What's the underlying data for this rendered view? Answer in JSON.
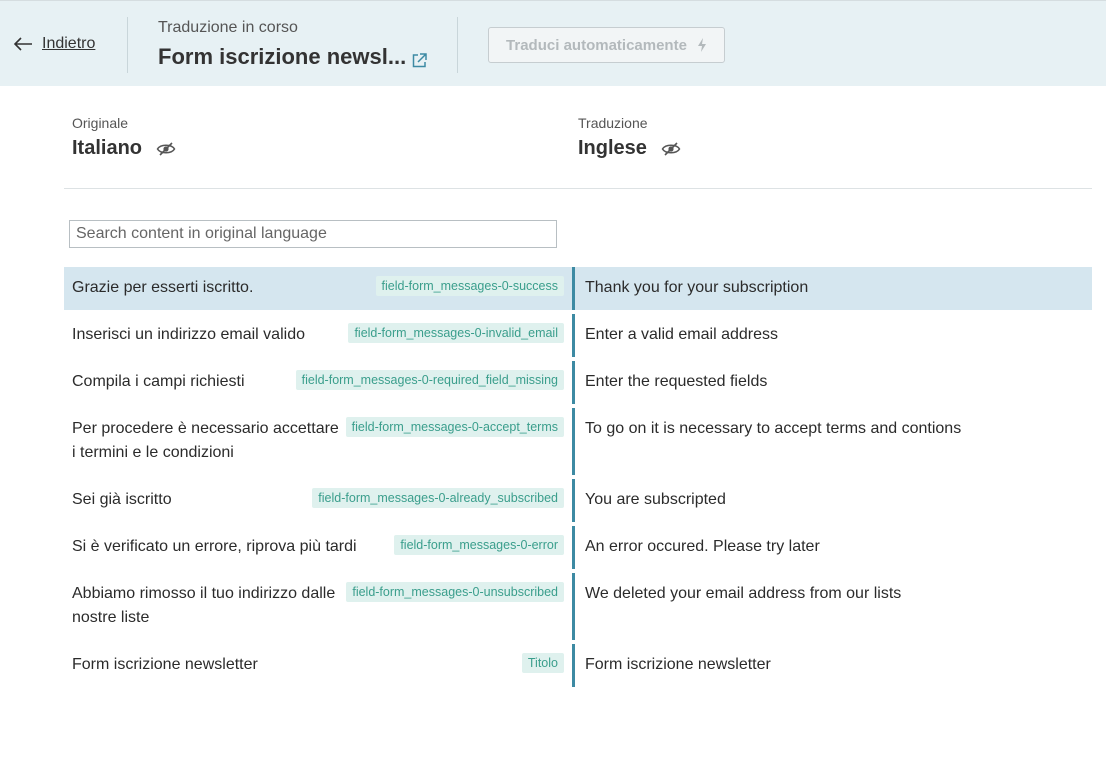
{
  "header": {
    "back_label": "Indietro",
    "status": "Traduzione in corso",
    "title": "Form iscrizione newsl...",
    "auto_translate_label": "Traduci automaticamente",
    "auto_translate_icon": "lightning-icon",
    "external_icon": "external-link-icon"
  },
  "original": {
    "caption": "Originale",
    "language": "Italiano",
    "icon": "eye-slash-icon"
  },
  "translation": {
    "caption": "Traduzione",
    "language": "Inglese",
    "icon": "eye-slash-icon"
  },
  "search": {
    "placeholder": "Search content in original language",
    "value": ""
  },
  "colors": {
    "accent": "#3d8aa3",
    "header_bg": "#e7f1f4",
    "active_row": "#d5e6ef",
    "key_bg": "#dff1ee",
    "key_text": "#3a9e8c"
  },
  "rows": [
    {
      "original": "Grazie per esserti iscritto.",
      "key": "field-form_messages-0-success",
      "translation": "Thank you for your subscription",
      "active": true
    },
    {
      "original": "Inserisci un indirizzo email valido",
      "key": "field-form_messages-0-invalid_email",
      "translation": "Enter a valid email address",
      "active": false
    },
    {
      "original": "Compila i campi richiesti",
      "key": "field-form_messages-0-required_field_missing",
      "translation": "Enter the requested fields",
      "active": false
    },
    {
      "original": "Per procedere è necessario accettare i termini e le condizioni",
      "key": "field-form_messages-0-accept_terms",
      "translation": "To go on it is necessary to accept terms and contions",
      "active": false
    },
    {
      "original": "Sei già iscritto",
      "key": "field-form_messages-0-already_subscribed",
      "translation": "You are subscripted",
      "active": false
    },
    {
      "original": "Si è verificato un errore, riprova più tardi",
      "key": "field-form_messages-0-error",
      "translation": "An error occured. Please try later",
      "active": false
    },
    {
      "original": "Abbiamo rimosso il tuo indirizzo dalle nostre liste",
      "key": "field-form_messages-0-unsubscribed",
      "translation": "We deleted your email address from our lists",
      "active": false
    },
    {
      "original": "Form iscrizione newsletter",
      "key": "Titolo",
      "translation": "Form iscrizione newsletter",
      "active": false
    }
  ]
}
